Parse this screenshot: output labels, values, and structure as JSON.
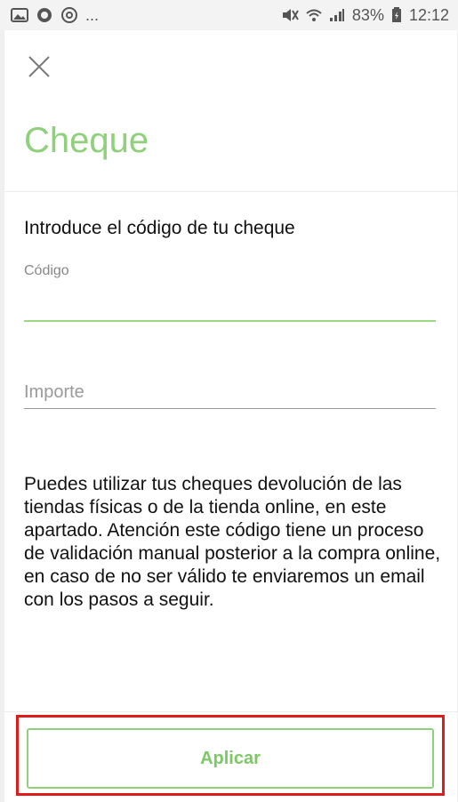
{
  "status_bar": {
    "left_icons": [
      "image-icon",
      "message-icon",
      "sync-icon"
    ],
    "left_more": "...",
    "right_icons": [
      "mute-icon",
      "wifi-icon",
      "signal-icon"
    ],
    "battery": "83%",
    "battery_icon": "battery-icon",
    "time": "12:12"
  },
  "header": {
    "close_icon": "close-icon",
    "title": "Cheque"
  },
  "form": {
    "intro": "Introduce el código de tu cheque",
    "code_label": "Código",
    "code_value": "",
    "amount_placeholder": "Importe",
    "amount_value": "",
    "info": "Puedes utilizar tus cheques devolución de las tiendas físicas o de la tienda online, en este apartado. Atención este código tiene un proceso de validación manual posterior a la compra online, en caso de no ser válido te enviaremos un email con los pasos a seguir."
  },
  "footer": {
    "apply_label": "Aplicar"
  },
  "colors": {
    "accent": "#8fd07a",
    "highlight": "#e01b1b"
  }
}
